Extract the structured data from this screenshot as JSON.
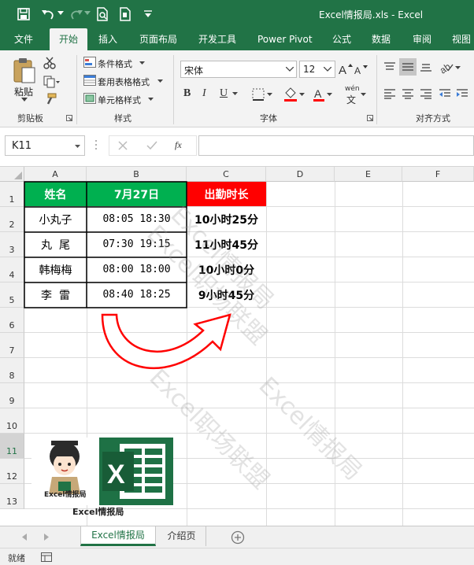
{
  "window": {
    "title": "Excel情报局.xls - Excel"
  },
  "tabs": [
    "文件",
    "开始",
    "插入",
    "页面布局",
    "开发工具",
    "Power Pivot",
    "公式",
    "数据",
    "审阅",
    "视图"
  ],
  "ribbon": {
    "clipboard": {
      "paste_label": "粘贴",
      "group_label": "剪贴板"
    },
    "styles": {
      "cond_format": "条件格式",
      "table_format": "套用表格格式",
      "cell_style": "单元格样式",
      "group_label": "样式"
    },
    "font": {
      "name": "宋体",
      "size": "12",
      "bold": "B",
      "italic": "I",
      "underline": "U",
      "group_label": "字体",
      "wen_label": "wén",
      "wen_char": "文"
    },
    "alignment": {
      "group_label": "对齐方式"
    }
  },
  "formula_bar": {
    "name_box": "K11",
    "fx": "fx",
    "value": ""
  },
  "columns": [
    "A",
    "B",
    "C",
    "D",
    "E",
    "F"
  ],
  "rows": [
    "1",
    "2",
    "3",
    "4",
    "5",
    "6",
    "7",
    "8",
    "9",
    "10",
    "11",
    "12",
    "13"
  ],
  "table": {
    "headers": [
      "姓名",
      "7月27日",
      "出勤时长"
    ],
    "rows": [
      {
        "name": "小丸子",
        "time": "08:05 18:30",
        "duration": "10小时25分"
      },
      {
        "name": "丸  尾",
        "time": "07:30 19:15",
        "duration": "11小时45分"
      },
      {
        "name": "韩梅梅",
        "time": "08:00 18:00",
        "duration": "10小时0分"
      },
      {
        "name": "李  雷",
        "time": "08:40 18:25",
        "duration": "9小时45分"
      }
    ]
  },
  "watermarks": [
    "Excel情报局",
    "Excel职场联盟",
    "Excel情报局",
    "Excel职场联盟"
  ],
  "logo": {
    "caption": "Excel情报局",
    "badge": "Excel情报局"
  },
  "sheet_tabs": [
    "Excel情报局",
    "介绍页"
  ],
  "status": {
    "ready": "就绪"
  },
  "colors": {
    "excel_green": "#217346",
    "header_green": "#00b050",
    "header_red": "#ff0000",
    "arrow_red": "#ff0000"
  }
}
